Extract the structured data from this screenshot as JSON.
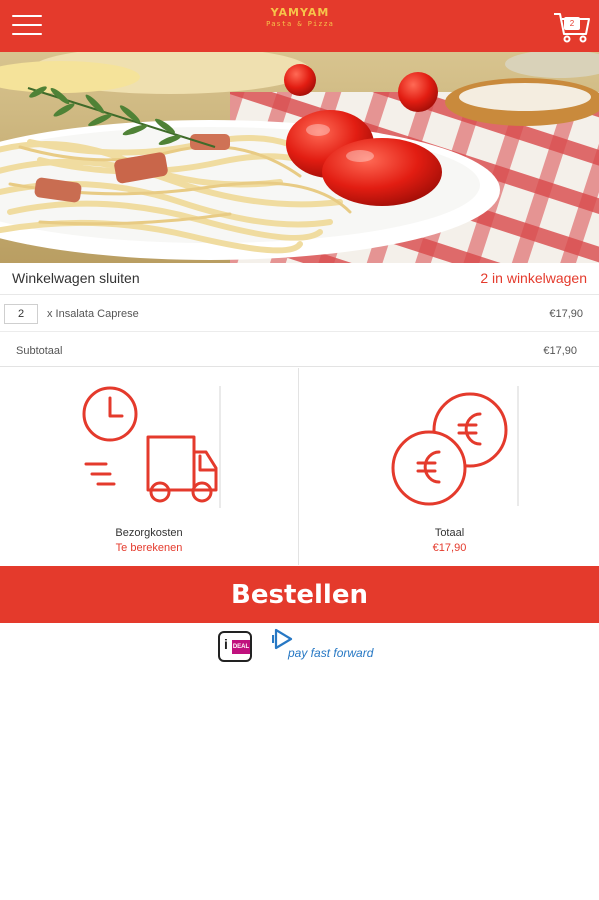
{
  "header": {
    "logo_text": "YAMYAM",
    "logo_subtitle": "Pasta & Pizza",
    "cart_count": "2"
  },
  "cart": {
    "close_label": "Winkelwagen sluiten",
    "count_label": "2 in winkelwagen",
    "items": [
      {
        "qty": "2",
        "name": "x Insalata Caprese",
        "price": "€17,90"
      }
    ],
    "subtotal_label": "Subtotaal",
    "subtotal_value": "€17,90"
  },
  "summary": {
    "delivery_label": "Bezorgkosten",
    "delivery_value": "Te berekenen",
    "total_label": "Totaal",
    "total_value": "€17,90"
  },
  "order_button_label": "Bestellen",
  "payment": {
    "ideal_letter": "i",
    "ideal_text": "DEAL",
    "payfastforward_text": "pay fast forward"
  },
  "icons": {
    "menu": "hamburger-menu-icon",
    "cart": "shopping-cart-icon",
    "delivery": "delivery-truck-clock-icon",
    "total": "euro-coins-icon"
  },
  "colors": {
    "accent": "#e43a2c",
    "logo": "#f6c34a",
    "ideal": "#c0117e",
    "payfastforward": "#2778c4"
  }
}
